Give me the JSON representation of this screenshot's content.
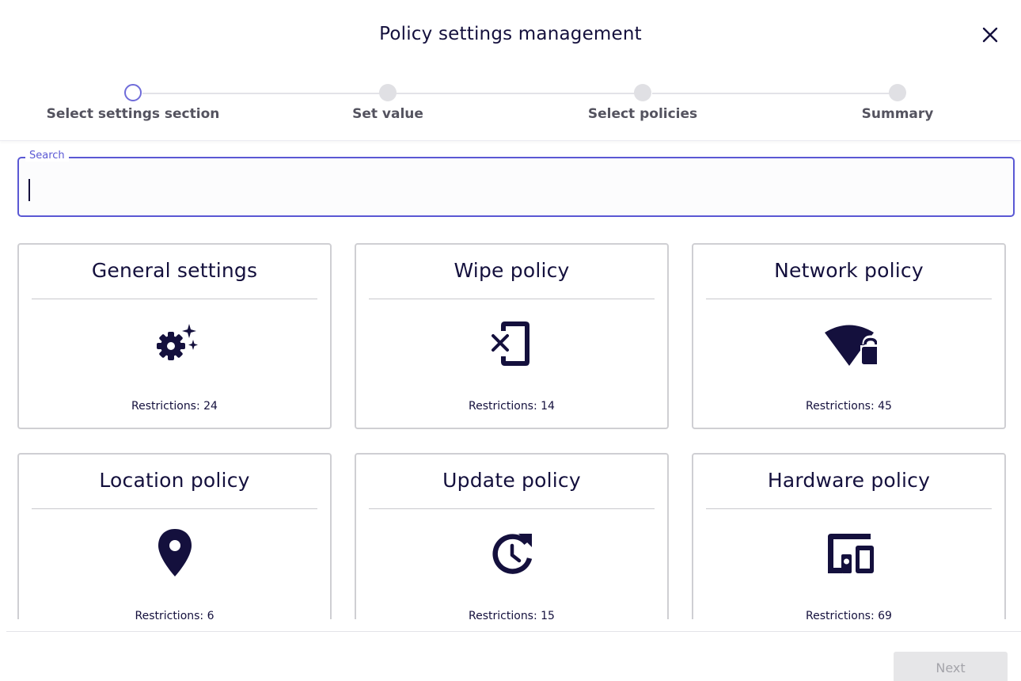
{
  "dialog": {
    "title": "Policy settings management",
    "close_icon": "close-icon"
  },
  "stepper": {
    "steps": [
      {
        "label": "Select settings section",
        "state": "active"
      },
      {
        "label": "Set value",
        "state": "pending"
      },
      {
        "label": "Select policies",
        "state": "pending"
      },
      {
        "label": "Summary",
        "state": "pending"
      }
    ]
  },
  "search": {
    "label": "Search",
    "value": "",
    "placeholder": ""
  },
  "cards": [
    {
      "title": "General settings",
      "icon": "gear-sparkle-icon",
      "count": "Restrictions: 24"
    },
    {
      "title": "Wipe policy",
      "icon": "phone-erase-icon",
      "count": "Restrictions: 14"
    },
    {
      "title": "Network policy",
      "icon": "wifi-lock-icon",
      "count": "Restrictions: 45"
    },
    {
      "title": "Location policy",
      "icon": "location-pin-icon",
      "count": "Restrictions: 6"
    },
    {
      "title": "Update policy",
      "icon": "update-clock-icon",
      "count": "Restrictions: 15"
    },
    {
      "title": "Hardware policy",
      "icon": "devices-icon",
      "count": "Restrictions: 69"
    }
  ],
  "footer": {
    "next_label": "Next",
    "next_enabled": false
  },
  "colors": {
    "accent": "#5a58d4",
    "text": "#14103d",
    "icon": "#14103d",
    "disabled_bg": "#e6e6e8",
    "disabled_text": "#a4a4aa"
  }
}
